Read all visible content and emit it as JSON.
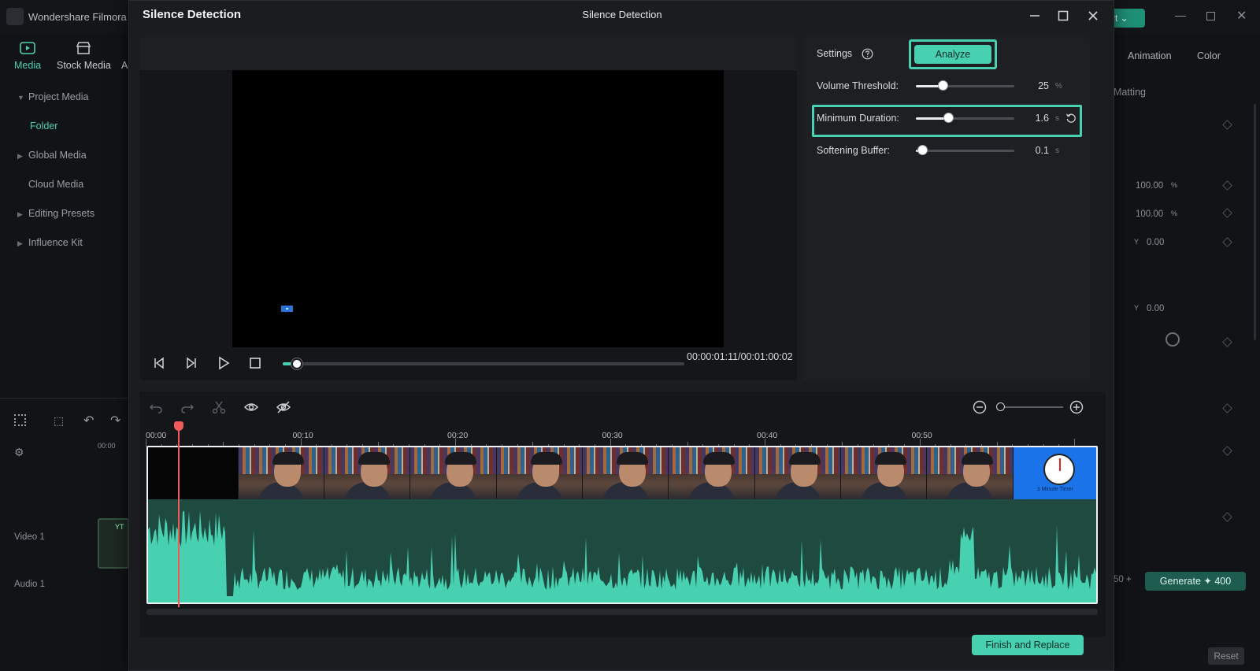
{
  "background_app": {
    "title": "Wondershare Filmora",
    "nav": [
      {
        "label": "Media",
        "icon": "media-icon"
      },
      {
        "label": "Stock Media",
        "icon": "stock-media-icon"
      },
      {
        "label": "A",
        "icon": "audio-icon"
      }
    ],
    "tree": [
      {
        "label": "Project Media",
        "expandable": true
      },
      {
        "label": "Folder",
        "selected": true
      },
      {
        "label": "Global Media",
        "expandable": true
      },
      {
        "label": "Cloud Media",
        "expandable": false
      },
      {
        "label": "Editing Presets",
        "expandable": true
      },
      {
        "label": "Influence Kit",
        "expandable": true
      }
    ],
    "right_tabs": [
      "Animation",
      "Color"
    ],
    "matting_label": "Matting",
    "values": {
      "scale_x": "100.00",
      "scale_x_unit": "%",
      "scale_y": "100.00",
      "scale_y_unit": "%",
      "pos_y_label": "Y",
      "pos_y": "0.00",
      "pos2_y_label": "Y",
      "pos2_y": "0.00"
    },
    "generate_label": "Generate",
    "generate_count": "400",
    "credits_prefix": "50",
    "reset_label": "Reset",
    "export_label": "rt",
    "track_video_label": "Video 1",
    "track_audio_label": "Audio 1",
    "timeline_time": "00:00",
    "clip_label": "YT"
  },
  "dialog": {
    "title": "Silence Detection",
    "window_title": "Silence Detection",
    "timecode": "00:00:01:11/00:01:00:02",
    "playback_progress": 0.035,
    "settings": {
      "label": "Settings",
      "analyze_label": "Analyze",
      "items": [
        {
          "label": "Volume Threshold:",
          "value": "25",
          "unit": "%",
          "fraction": 0.27
        },
        {
          "label": "Minimum Duration:",
          "value": "1.6",
          "unit": "s",
          "fraction": 0.33
        },
        {
          "label": "Softening Buffer:",
          "value": "0.1",
          "unit": "s",
          "fraction": 0.06
        }
      ]
    },
    "timeline": {
      "ticks": [
        "00:00",
        "00:10",
        "00:20",
        "00:30",
        "00:40",
        "00:50"
      ],
      "thumbnail_caption": "3 Minute Timer"
    },
    "finish_label": "Finish and Replace"
  },
  "colors": {
    "accent": "#48d1b1",
    "playhead": "#f05a5a",
    "wave": "#48d1b1"
  }
}
